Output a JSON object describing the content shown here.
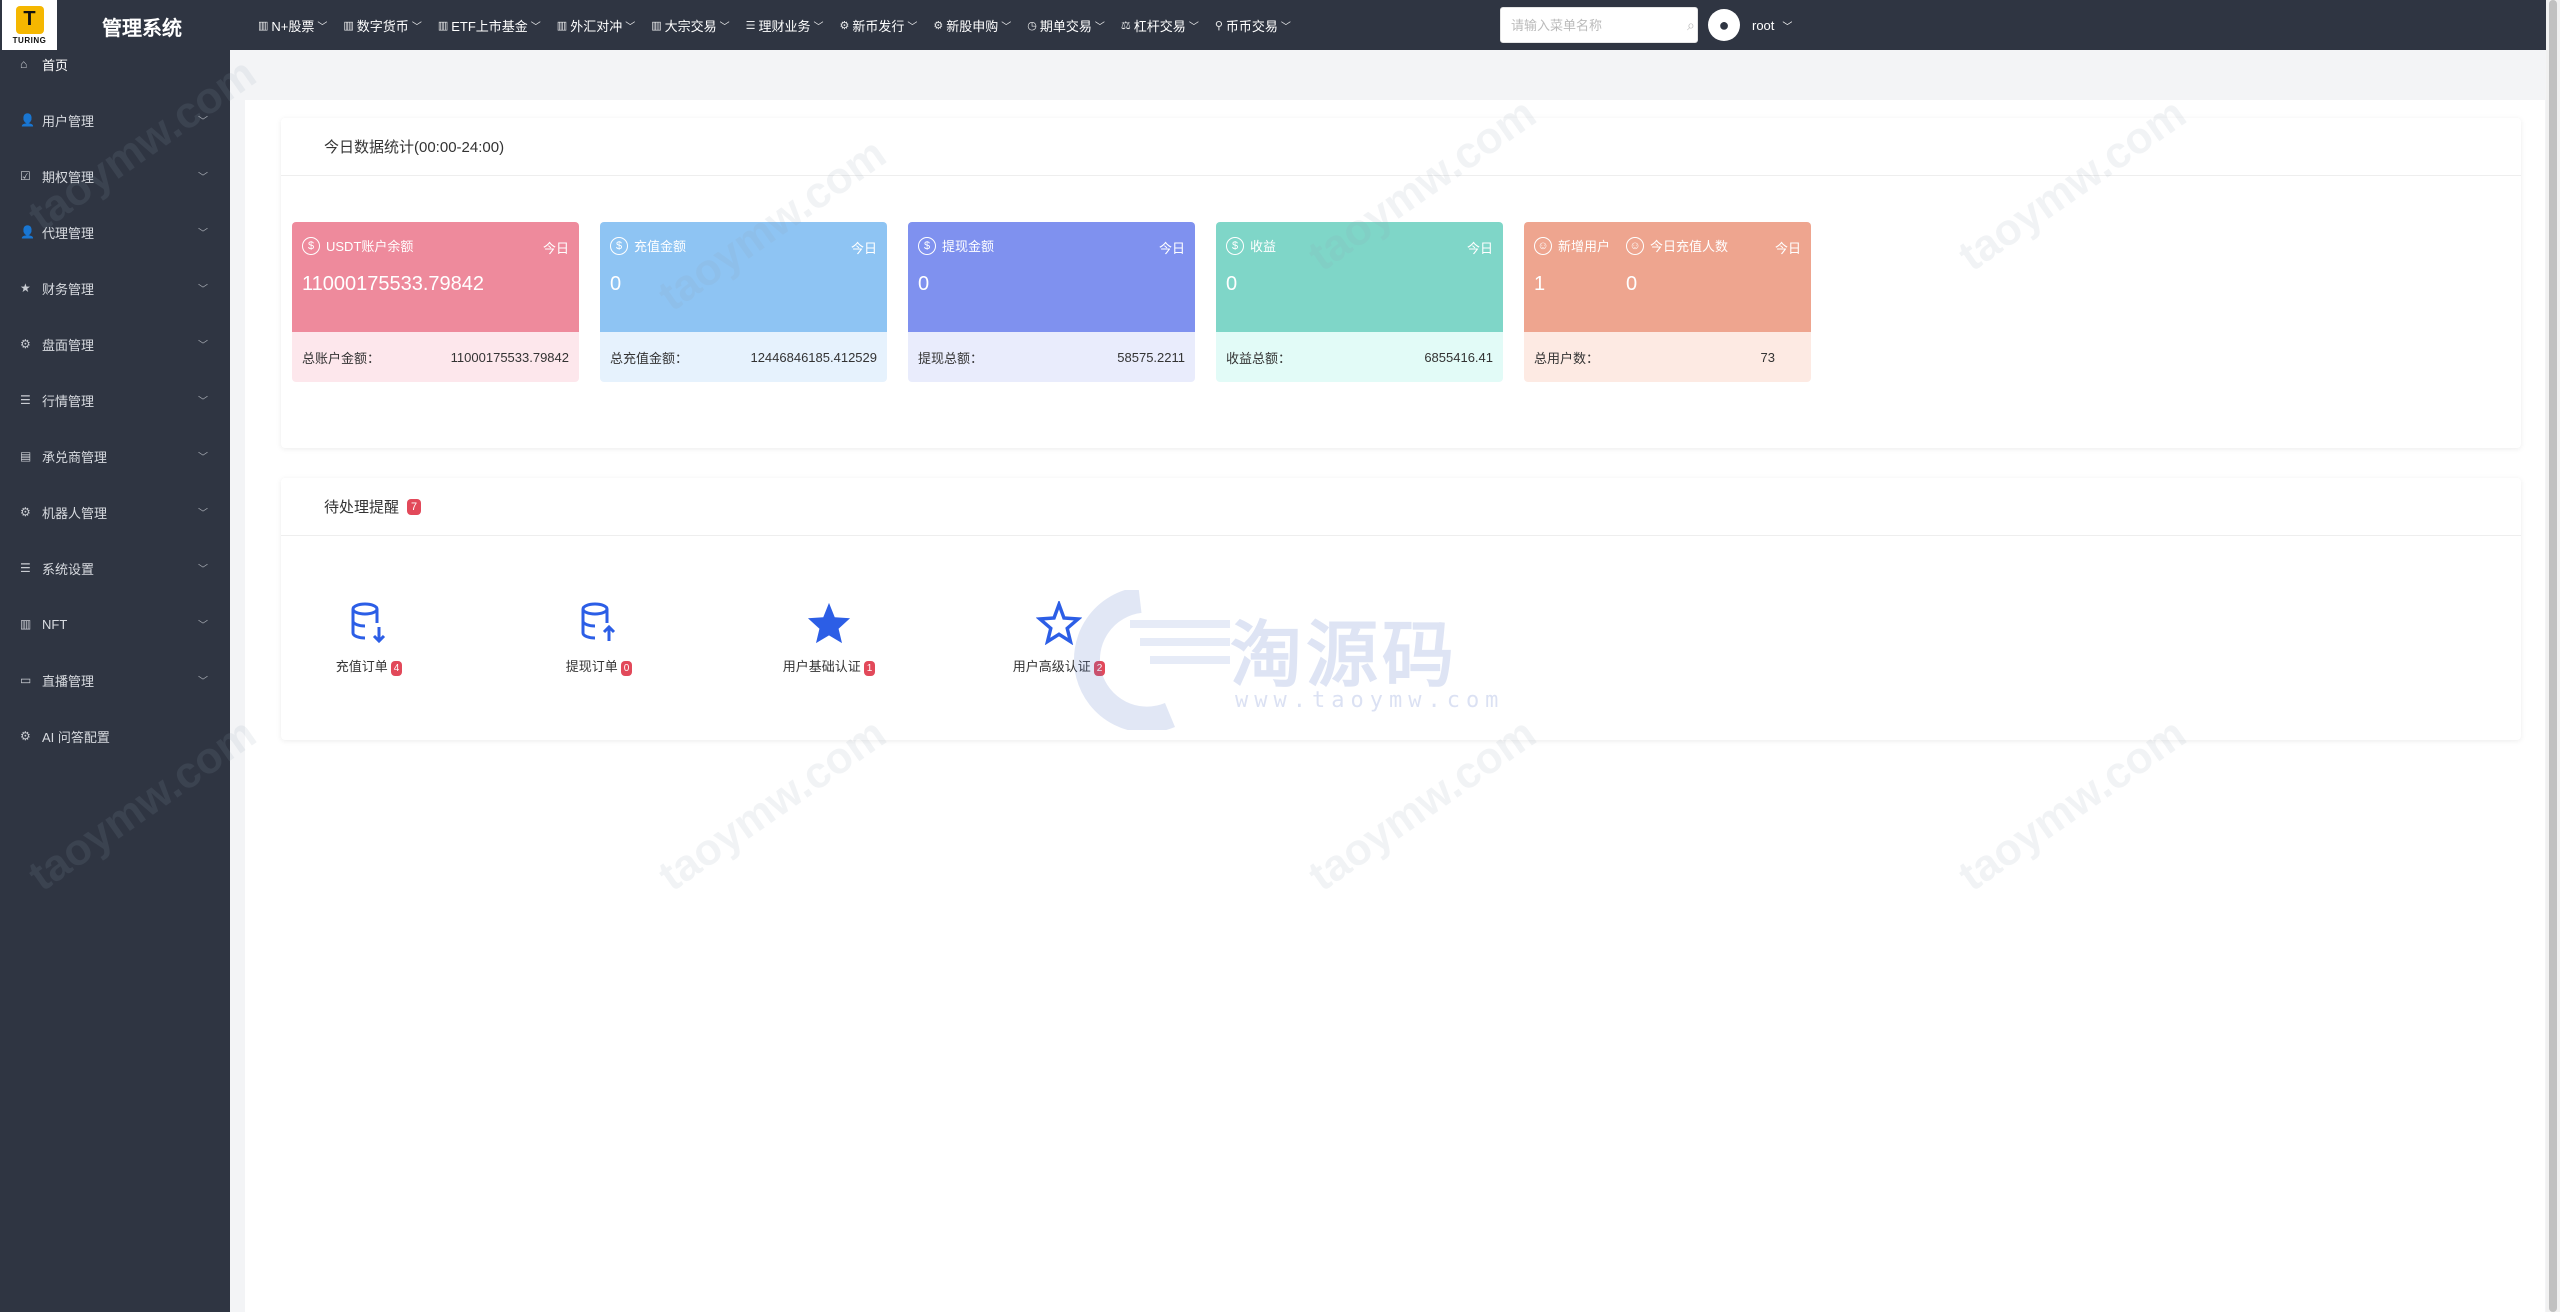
{
  "app": {
    "logo_text": "TURING",
    "title": "管理系统"
  },
  "topnav": [
    {
      "label": "N+股票",
      "icon": "bar-chart-icon"
    },
    {
      "label": "数字货币",
      "icon": "bar-chart-icon"
    },
    {
      "label": "ETF上市基金",
      "icon": "bar-chart-icon"
    },
    {
      "label": "外汇对冲",
      "icon": "bar-chart-icon"
    },
    {
      "label": "大宗交易",
      "icon": "bar-chart-icon"
    },
    {
      "label": "理财业务",
      "icon": "list-icon"
    },
    {
      "label": "新币发行",
      "icon": "gear-icon"
    },
    {
      "label": "新股申购",
      "icon": "gear-icon"
    },
    {
      "label": "期单交易",
      "icon": "clock-icon"
    },
    {
      "label": "杠杆交易",
      "icon": "lever-icon"
    },
    {
      "label": "币币交易",
      "icon": "pin-icon"
    }
  ],
  "search": {
    "placeholder": "请输入菜单名称",
    "value": ""
  },
  "user": {
    "name": "root"
  },
  "sidebar": [
    {
      "label": "首页",
      "icon": "home-icon",
      "expandable": false
    },
    {
      "label": "用户管理",
      "icon": "user-icon",
      "expandable": true
    },
    {
      "label": "期权管理",
      "icon": "checkbox-icon",
      "expandable": true
    },
    {
      "label": "代理管理",
      "icon": "user-icon",
      "expandable": true
    },
    {
      "label": "财务管理",
      "icon": "star-icon",
      "expandable": true
    },
    {
      "label": "盘面管理",
      "icon": "gear-icon",
      "expandable": true
    },
    {
      "label": "行情管理",
      "icon": "list-icon",
      "expandable": true
    },
    {
      "label": "承兑商管理",
      "icon": "table-icon",
      "expandable": true
    },
    {
      "label": "机器人管理",
      "icon": "gear-icon",
      "expandable": true
    },
    {
      "label": "系统设置",
      "icon": "list-icon",
      "expandable": true
    },
    {
      "label": "NFT",
      "icon": "bar-chart-icon",
      "expandable": true
    },
    {
      "label": "直播管理",
      "icon": "video-icon",
      "expandable": true
    },
    {
      "label": "AI 问答配置",
      "icon": "gear-icon",
      "expandable": false
    }
  ],
  "stats_panel": {
    "title": "今日数据统计(00:00-24:00)",
    "cards": [
      {
        "label": "USDT账户余额",
        "period": "今日",
        "value": "11000175533.79842",
        "footer_label": "总账户金额：",
        "footer_value": "11000175533.79842",
        "color": "#ee8a9c"
      },
      {
        "label": "充值金额",
        "period": "今日",
        "value": "0",
        "footer_label": "总充值金额：",
        "footer_value": "12446846185.412529",
        "color": "#8ec4f3"
      },
      {
        "label": "提现金额",
        "period": "今日",
        "value": "0",
        "footer_label": "提现总额：",
        "footer_value": "58575.2211",
        "color": "#7f91ef"
      },
      {
        "label": "收益",
        "period": "今日",
        "value": "0",
        "footer_label": "收益总额：",
        "footer_value": "6855416.41",
        "color": "#7fd6c8"
      }
    ],
    "dual_card": {
      "label_a": "新增用户",
      "value_a": "1",
      "label_b": "今日充值人数",
      "value_b": "0",
      "period": "今日",
      "footer_label": "总用户数：",
      "footer_value": "73",
      "color": "#eea58f"
    }
  },
  "pending_panel": {
    "title": "待处理提醒",
    "badge": "7",
    "items": [
      {
        "label": "充值订单",
        "badge": "4",
        "icon": "database-download-icon"
      },
      {
        "label": "提现订单",
        "badge": "0",
        "icon": "database-upload-icon"
      },
      {
        "label": "用户基础认证",
        "badge": "1",
        "icon": "star-filled-icon"
      },
      {
        "label": "用户高级认证",
        "badge": "2",
        "icon": "star-outline-icon"
      }
    ]
  },
  "watermark": {
    "text": "taoymw.com",
    "brand": "淘源码",
    "brand_url": "www.taoymw.com"
  },
  "colors": {
    "sidebar_bg": "#2f3542",
    "accent_blue": "#2c5ee6",
    "badge_red": "#e2495a"
  }
}
